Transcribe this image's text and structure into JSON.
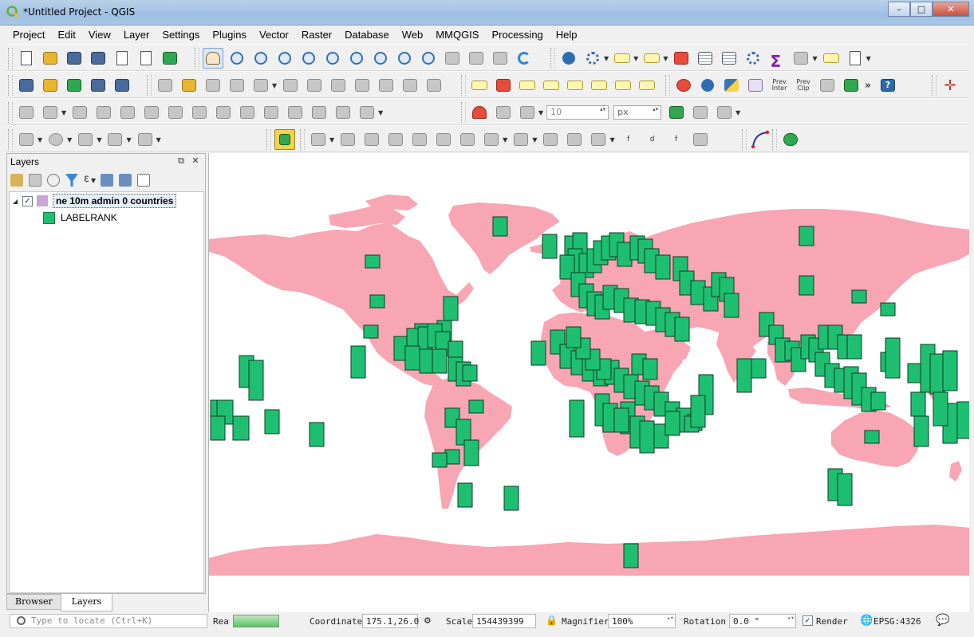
{
  "window": {
    "title": "*Untitled Project - QGIS"
  },
  "menu": [
    "Project",
    "Edit",
    "View",
    "Layer",
    "Settings",
    "Plugins",
    "Vector",
    "Raster",
    "Database",
    "Web",
    "MMQGIS",
    "Processing",
    "Help"
  ],
  "toolbar": {
    "label_text": "abc",
    "prev_inter": "Prev\nInter",
    "prev_clip": "Prev\nClip",
    "more": "»",
    "tolerance_value": "10",
    "tolerance_unit": "px",
    "tp_letters": [
      "f",
      "d",
      "f"
    ]
  },
  "layers_panel": {
    "title": "Layers",
    "layer": {
      "name": "ne 10m admin 0 countries",
      "checked": true
    },
    "legend": {
      "label": "LABELRANK",
      "color": "#1fbf72"
    }
  },
  "bottom_tabs": [
    "Browser",
    "Layers"
  ],
  "status": {
    "locator_placeholder": "Type to locate (Ctrl+K)",
    "render_progress_label": "Rea",
    "coordinate_label": "Coordinate",
    "coordinate_value": "175.1,26.0",
    "scale_label": "Scale",
    "scale_value": "154439399",
    "magnifier_label": "Magnifier",
    "magnifier_value": "100%",
    "rotation_label": "Rotation",
    "rotation_value": "0.0 °",
    "render_label": "Render",
    "render_checked": true,
    "crs": "EPSG:4326"
  },
  "map": {
    "land_color": "#f8a5b4",
    "label_box_color": "#1fbf72"
  }
}
